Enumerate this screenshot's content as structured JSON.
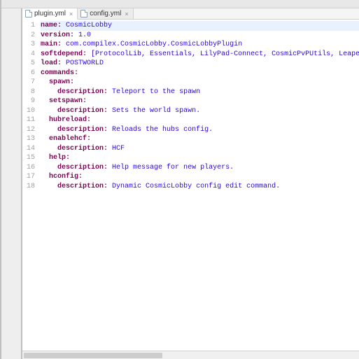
{
  "tabs": [
    {
      "label": "plugin.yml",
      "active": true
    },
    {
      "label": "config.yml",
      "active": false
    }
  ],
  "lines": [
    {
      "n": 1,
      "type": "kv",
      "key": "name",
      "val": "CosmicLobby",
      "highlight": true
    },
    {
      "n": 2,
      "type": "kv",
      "key": "version",
      "val": "1.0"
    },
    {
      "n": 3,
      "type": "kv",
      "key": "main",
      "val": "com.compilex.CosmicLobby.CosmicLobbyPlugin"
    },
    {
      "n": 4,
      "type": "kv",
      "key": "softdepend",
      "val": "[ProtocolLib, Essentials, LilyPad-Connect, CosmicPvPUtils, Leaper]"
    },
    {
      "n": 5,
      "type": "kv",
      "key": "load",
      "val": "POSTWORLD"
    },
    {
      "n": 6,
      "type": "k",
      "key": "commands"
    },
    {
      "n": 7,
      "type": "ki",
      "indent": 1,
      "key": "spawn"
    },
    {
      "n": 8,
      "type": "kvi",
      "indent": 2,
      "key": "description",
      "val": "Teleport to the spawn"
    },
    {
      "n": 9,
      "type": "ki",
      "indent": 1,
      "key": "setspawn"
    },
    {
      "n": 10,
      "type": "kvi",
      "indent": 2,
      "key": "description",
      "val": "Sets the world spawn."
    },
    {
      "n": 11,
      "type": "ki",
      "indent": 1,
      "key": "hubreload"
    },
    {
      "n": 12,
      "type": "kvi",
      "indent": 2,
      "key": "description",
      "val": "Reloads the hubs config."
    },
    {
      "n": 13,
      "type": "ki",
      "indent": 1,
      "key": "enablehcf"
    },
    {
      "n": 14,
      "type": "kvi",
      "indent": 2,
      "key": "description",
      "val": "HCF"
    },
    {
      "n": 15,
      "type": "ki",
      "indent": 1,
      "key": "help"
    },
    {
      "n": 16,
      "type": "kvi",
      "indent": 2,
      "key": "description",
      "val": "Help message for new players."
    },
    {
      "n": 17,
      "type": "ki",
      "indent": 1,
      "key": "hconfig"
    },
    {
      "n": 18,
      "type": "kvi",
      "indent": 2,
      "key": "description",
      "val": "Dynamic CosmicLobby config edit command."
    }
  ]
}
